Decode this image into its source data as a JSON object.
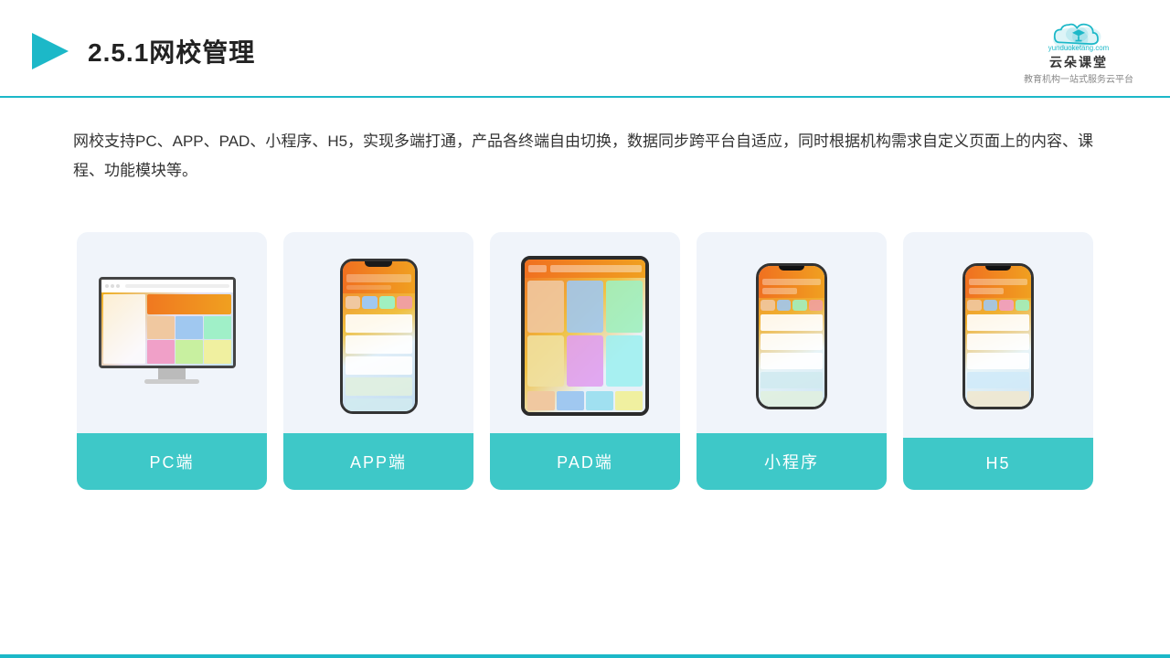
{
  "header": {
    "title": "2.5.1网校管理",
    "logo_name": "云朵课堂",
    "logo_tagline": "教育机构一站式服务云平台",
    "logo_url": "yunduoketang.com"
  },
  "description": "网校支持PC、APP、PAD、小程序、H5，实现多端打通，产品各终端自由切换，数据同步跨平台自适应，同时根据机构需求自定义页面上的内容、课程、功能模块等。",
  "cards": [
    {
      "label": "PC端",
      "type": "pc"
    },
    {
      "label": "APP端",
      "type": "phone"
    },
    {
      "label": "PAD端",
      "type": "tablet"
    },
    {
      "label": "小程序",
      "type": "mini-phone"
    },
    {
      "label": "H5",
      "type": "mini-phone2"
    }
  ]
}
